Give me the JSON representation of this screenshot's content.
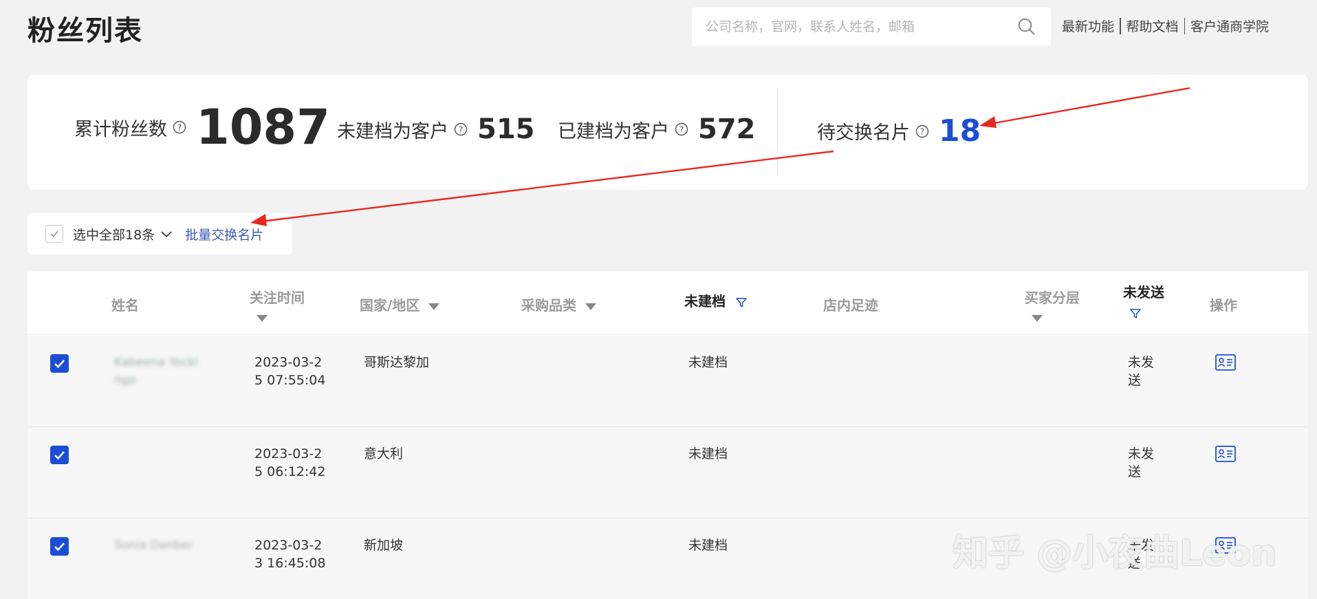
{
  "page": {
    "title": "粉丝列表"
  },
  "search": {
    "placeholder": "公司名称，官网，联系人姓名，邮箱"
  },
  "top_links": [
    "最新功能",
    "帮助文档",
    "客户通商学院"
  ],
  "stats": [
    {
      "label": "累计粉丝数",
      "value": "1087"
    },
    {
      "label": "未建档为客户",
      "value": "515"
    },
    {
      "label": "已建档为客户",
      "value": "572"
    },
    {
      "label": "待交换名片",
      "value": "18"
    }
  ],
  "selection": {
    "select_all_label": "选中全部18条",
    "batch_action": "批量交换名片"
  },
  "table": {
    "headers": {
      "name": "姓名",
      "follow_time": "关注时间",
      "country": "国家/地区",
      "category": "采购品类",
      "archive": "未建档",
      "footprint": "店内足迹",
      "tier": "买家分层",
      "send": "未发送",
      "action": "操作"
    },
    "rows": [
      {
        "name": "Kabeena Yocki ngo",
        "follow_time": "2023-03-25 07:55:04",
        "country": "哥斯达黎加",
        "archive": "未建档",
        "send": "未发送"
      },
      {
        "name": "",
        "follow_time": "2023-03-25 06:12:42",
        "country": "意大利",
        "archive": "未建档",
        "send": "未发送"
      },
      {
        "name": "Sonia Danber",
        "follow_time": "2023-03-23 16:45:08",
        "country": "新加坡",
        "archive": "未建档",
        "send": "未发送"
      }
    ]
  },
  "watermark": "知乎 @小夜曲Leon",
  "colors": {
    "accent": "#1a4ed6",
    "link": "#3c5bb8",
    "arrow": "#e8281e",
    "highlight_value": "#1a4ed6"
  }
}
